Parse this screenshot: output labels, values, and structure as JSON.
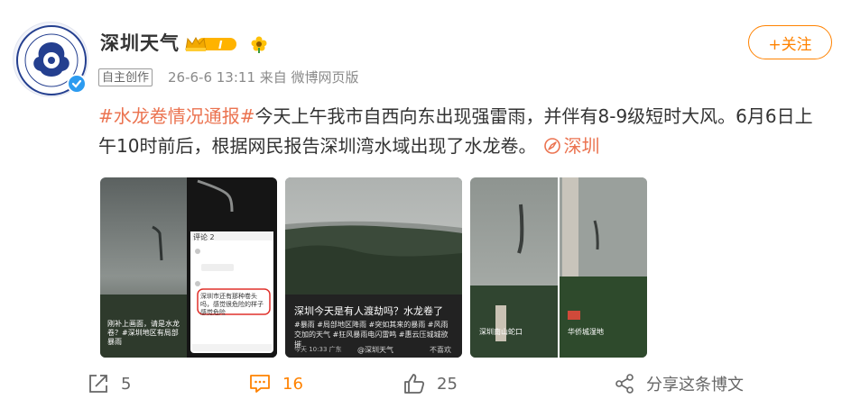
{
  "header": {
    "account_name": "深圳天气",
    "vip_level": "I",
    "tag": "自主创作",
    "meta": "26-6-6 13:11  来自 微博网页版",
    "follow_label": "+关注"
  },
  "post": {
    "hashtag": "#水龙卷情况通报#",
    "text": "今天上午我市自西向东出现强雷雨，并伴有8-9级短时大风。6月6日上午10时前后，根据网民报告深圳湾水域出现了水龙卷。",
    "location": "深圳"
  },
  "media": {
    "image1": {
      "caption": "刚补上画面，请是水龙卷？#深圳地区有局部暴雨",
      "comment_title": "评论 2",
      "comment_text": "深圳市还有那种卷头吗，感觉很危险的样子感觉危险"
    },
    "image2": {
      "caption": "深圳今天是有人渡劫吗？水龙卷了",
      "tags": "#暴雨 #局部地区降雨 #突如其来的暴雨 #风雨交加的天气 #狂风暴雨电闪雷鸣 #惠云压城城欲摧",
      "footer_left": "今天 10:33 广东",
      "footer_mid": "@深圳天气",
      "footer_right": "不喜欢"
    },
    "image3": {
      "left_caption": "深圳南山蛇口",
      "right_caption": "华侨城湿地"
    }
  },
  "actions": {
    "repost_count": "5",
    "comment_count": "16",
    "like_count": "25",
    "share_label": "分享这条博文"
  },
  "colors": {
    "accent": "#ff8200",
    "hashtag": "#eb7350",
    "verified": "#2c9bf0"
  }
}
